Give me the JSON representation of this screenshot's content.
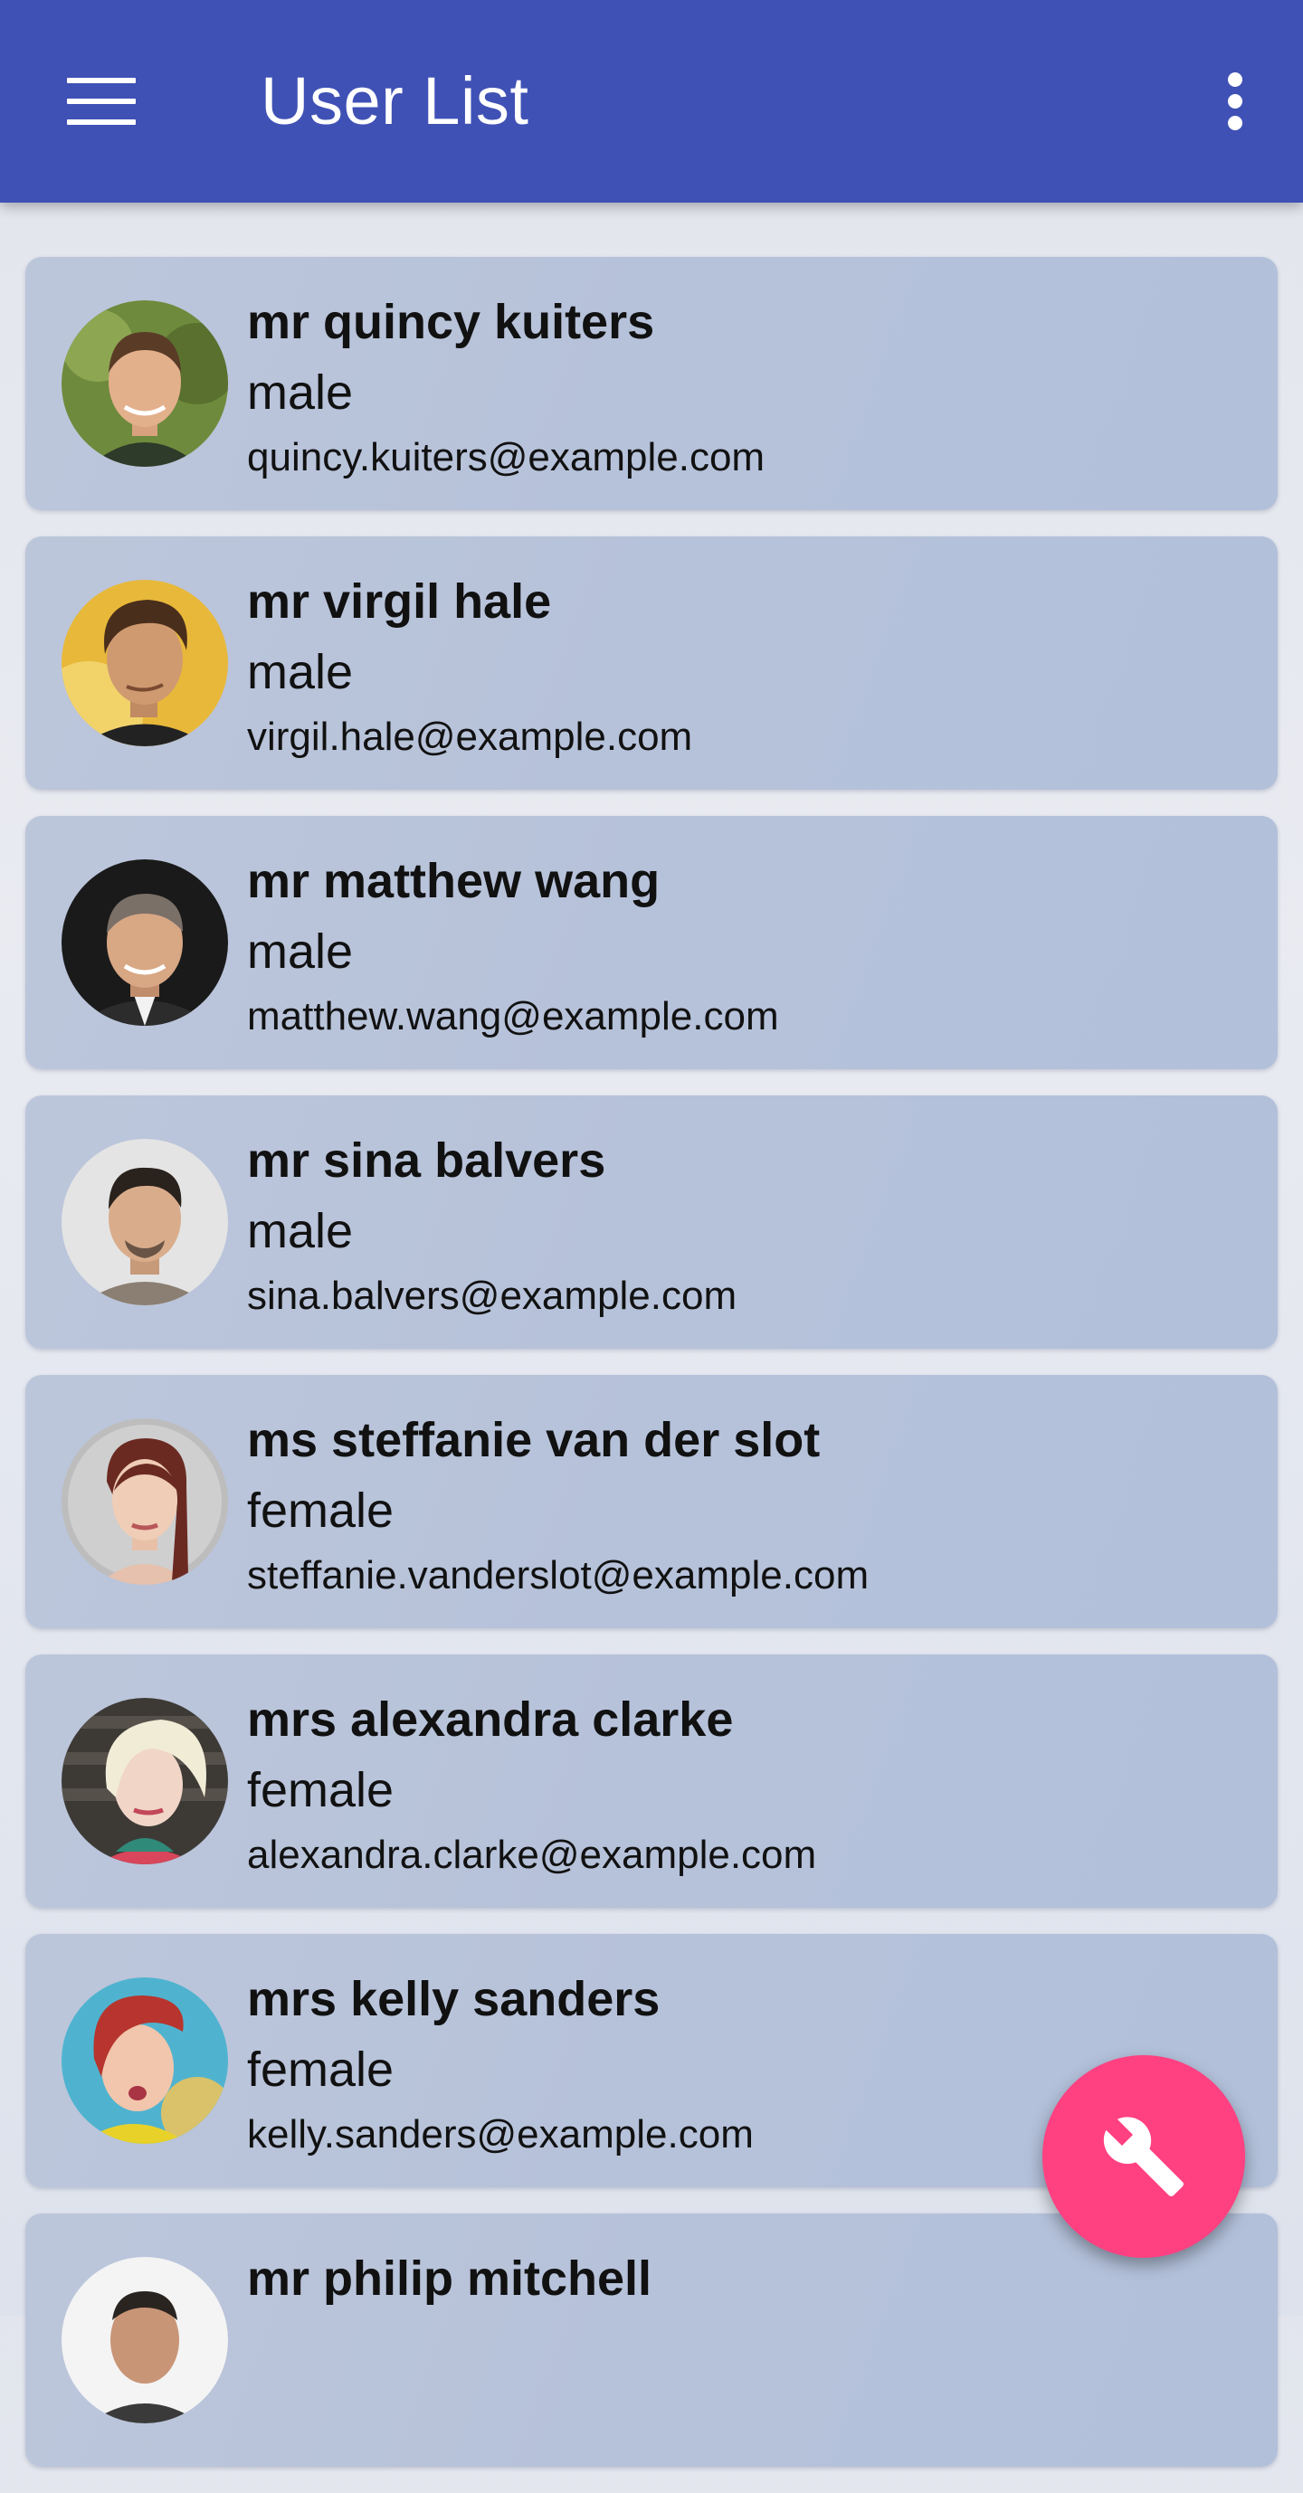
{
  "app_bar": {
    "title": "User List",
    "menu_icon": "menu-icon",
    "overflow_icon": "more-vert-icon",
    "background_color": "#3f51b5"
  },
  "users": [
    {
      "name": "mr quincy kuiters",
      "gender": "male",
      "email": "quincy.kuiters@example.com",
      "avatar_icon": "avatar-photo"
    },
    {
      "name": "mr virgil hale",
      "gender": "male",
      "email": "virgil.hale@example.com",
      "avatar_icon": "avatar-photo"
    },
    {
      "name": "mr matthew wang",
      "gender": "male",
      "email": "matthew.wang@example.com",
      "avatar_icon": "avatar-photo"
    },
    {
      "name": "mr sina balvers",
      "gender": "male",
      "email": "sina.balvers@example.com",
      "avatar_icon": "avatar-photo"
    },
    {
      "name": "ms steffanie van der slot",
      "gender": "female",
      "email": "steffanie.vanderslot@example.com",
      "avatar_icon": "avatar-photo"
    },
    {
      "name": "mrs alexandra clarke",
      "gender": "female",
      "email": "alexandra.clarke@example.com",
      "avatar_icon": "avatar-photo"
    },
    {
      "name": "mrs kelly sanders",
      "gender": "female",
      "email": "kelly.sanders@example.com",
      "avatar_icon": "avatar-photo"
    },
    {
      "name": "mr philip mitchell",
      "gender": "",
      "email": "",
      "avatar_icon": "avatar-photo"
    }
  ],
  "fab": {
    "icon": "wrench-icon",
    "color": "#ff4081"
  }
}
